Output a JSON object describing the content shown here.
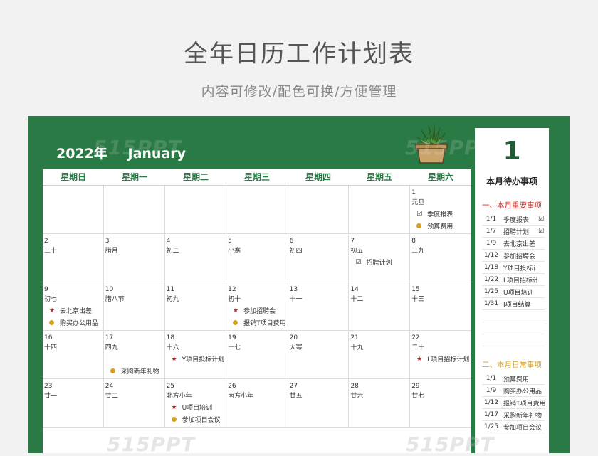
{
  "header": {
    "title": "全年日历工作计划表",
    "subtitle": "内容可修改/配色可换/方便管理"
  },
  "calendar": {
    "year": "2022年",
    "month": "January",
    "weekdays": [
      "星期日",
      "星期一",
      "星期二",
      "星期三",
      "星期四",
      "星期五",
      "星期六"
    ],
    "cells": [
      {
        "day": "",
        "lunar": "",
        "events": []
      },
      {
        "day": "",
        "lunar": "",
        "events": []
      },
      {
        "day": "",
        "lunar": "",
        "events": []
      },
      {
        "day": "",
        "lunar": "",
        "events": []
      },
      {
        "day": "",
        "lunar": "",
        "events": []
      },
      {
        "day": "",
        "lunar": "",
        "events": []
      },
      {
        "day": "1",
        "lunar": "元旦",
        "events": [
          {
            "mark": "check",
            "text": "季度报表"
          },
          {
            "mark": "dot",
            "text": "预算费用"
          }
        ]
      },
      {
        "day": "2",
        "lunar": "三十",
        "events": []
      },
      {
        "day": "3",
        "lunar": "腊月",
        "events": []
      },
      {
        "day": "4",
        "lunar": "初二",
        "events": []
      },
      {
        "day": "5",
        "lunar": "小寒",
        "events": []
      },
      {
        "day": "6",
        "lunar": "初四",
        "events": []
      },
      {
        "day": "7",
        "lunar": "初五",
        "events": [
          {
            "mark": "check",
            "text": "招聘计划"
          }
        ]
      },
      {
        "day": "8",
        "lunar": "三九",
        "events": []
      },
      {
        "day": "9",
        "lunar": "初七",
        "events": [
          {
            "mark": "star",
            "text": "去北京出差"
          },
          {
            "mark": "dot",
            "text": "购买办公用品"
          }
        ]
      },
      {
        "day": "10",
        "lunar": "腊八节",
        "events": []
      },
      {
        "day": "11",
        "lunar": "初九",
        "events": []
      },
      {
        "day": "12",
        "lunar": "初十",
        "events": [
          {
            "mark": "star",
            "text": "参加招聘会"
          },
          {
            "mark": "dot",
            "text": "报销T项目费用"
          }
        ]
      },
      {
        "day": "13",
        "lunar": "十一",
        "events": []
      },
      {
        "day": "14",
        "lunar": "十二",
        "events": []
      },
      {
        "day": "15",
        "lunar": "十三",
        "events": []
      },
      {
        "day": "16",
        "lunar": "十四",
        "events": []
      },
      {
        "day": "17",
        "lunar": "四九",
        "events": [
          {
            "mark": "none",
            "text": ""
          },
          {
            "mark": "dot",
            "text": "采购新年礼物"
          }
        ]
      },
      {
        "day": "18",
        "lunar": "十六",
        "events": [
          {
            "mark": "star",
            "text": "Y项目投标计划"
          }
        ]
      },
      {
        "day": "19",
        "lunar": "十七",
        "events": []
      },
      {
        "day": "20",
        "lunar": "大寒",
        "events": []
      },
      {
        "day": "21",
        "lunar": "十九",
        "events": []
      },
      {
        "day": "22",
        "lunar": "二十",
        "events": [
          {
            "mark": "star",
            "text": "L项目招标计划"
          }
        ]
      },
      {
        "day": "23",
        "lunar": "廿一",
        "events": []
      },
      {
        "day": "24",
        "lunar": "廿二",
        "events": []
      },
      {
        "day": "25",
        "lunar": "北方小年",
        "events": [
          {
            "mark": "star",
            "text": "U项目培训"
          },
          {
            "mark": "dot",
            "text": "参加项目会议"
          }
        ]
      },
      {
        "day": "26",
        "lunar": "南方小年",
        "events": []
      },
      {
        "day": "27",
        "lunar": "廿五",
        "events": []
      },
      {
        "day": "28",
        "lunar": "廿六",
        "events": []
      },
      {
        "day": "29",
        "lunar": "廿七",
        "events": []
      }
    ]
  },
  "sidebar": {
    "month_number": "1",
    "todo_title": "本月待办事项",
    "important_title": "一、本月重要事项",
    "important": [
      {
        "date": "1/1",
        "text": "季度报表",
        "check": "☑"
      },
      {
        "date": "1/7",
        "text": "招聘计划",
        "check": "☑"
      },
      {
        "date": "1/9",
        "text": "去北京出差",
        "check": ""
      },
      {
        "date": "1/12",
        "text": "参加招聘会",
        "check": ""
      },
      {
        "date": "1/18",
        "text": "Y项目投标计划",
        "check": ""
      },
      {
        "date": "1/22",
        "text": "L项目招标计划",
        "check": ""
      },
      {
        "date": "1/25",
        "text": "U项目培训",
        "check": ""
      },
      {
        "date": "1/31",
        "text": "I项目结算",
        "check": ""
      }
    ],
    "daily_title": "二、本月日常事项",
    "daily": [
      {
        "date": "1/1",
        "text": "预算费用"
      },
      {
        "date": "1/9",
        "text": "购买办公用品"
      },
      {
        "date": "1/12",
        "text": "报销T项目费用"
      },
      {
        "date": "1/17",
        "text": "采购新年礼物"
      },
      {
        "date": "1/25",
        "text": "参加项目会议"
      }
    ]
  },
  "watermark": "515PPT",
  "colors": {
    "green": "#2a7a46",
    "star": "#c8201e",
    "dot": "#d8a11a",
    "important": "#d9271f",
    "daily": "#d8a11a"
  }
}
